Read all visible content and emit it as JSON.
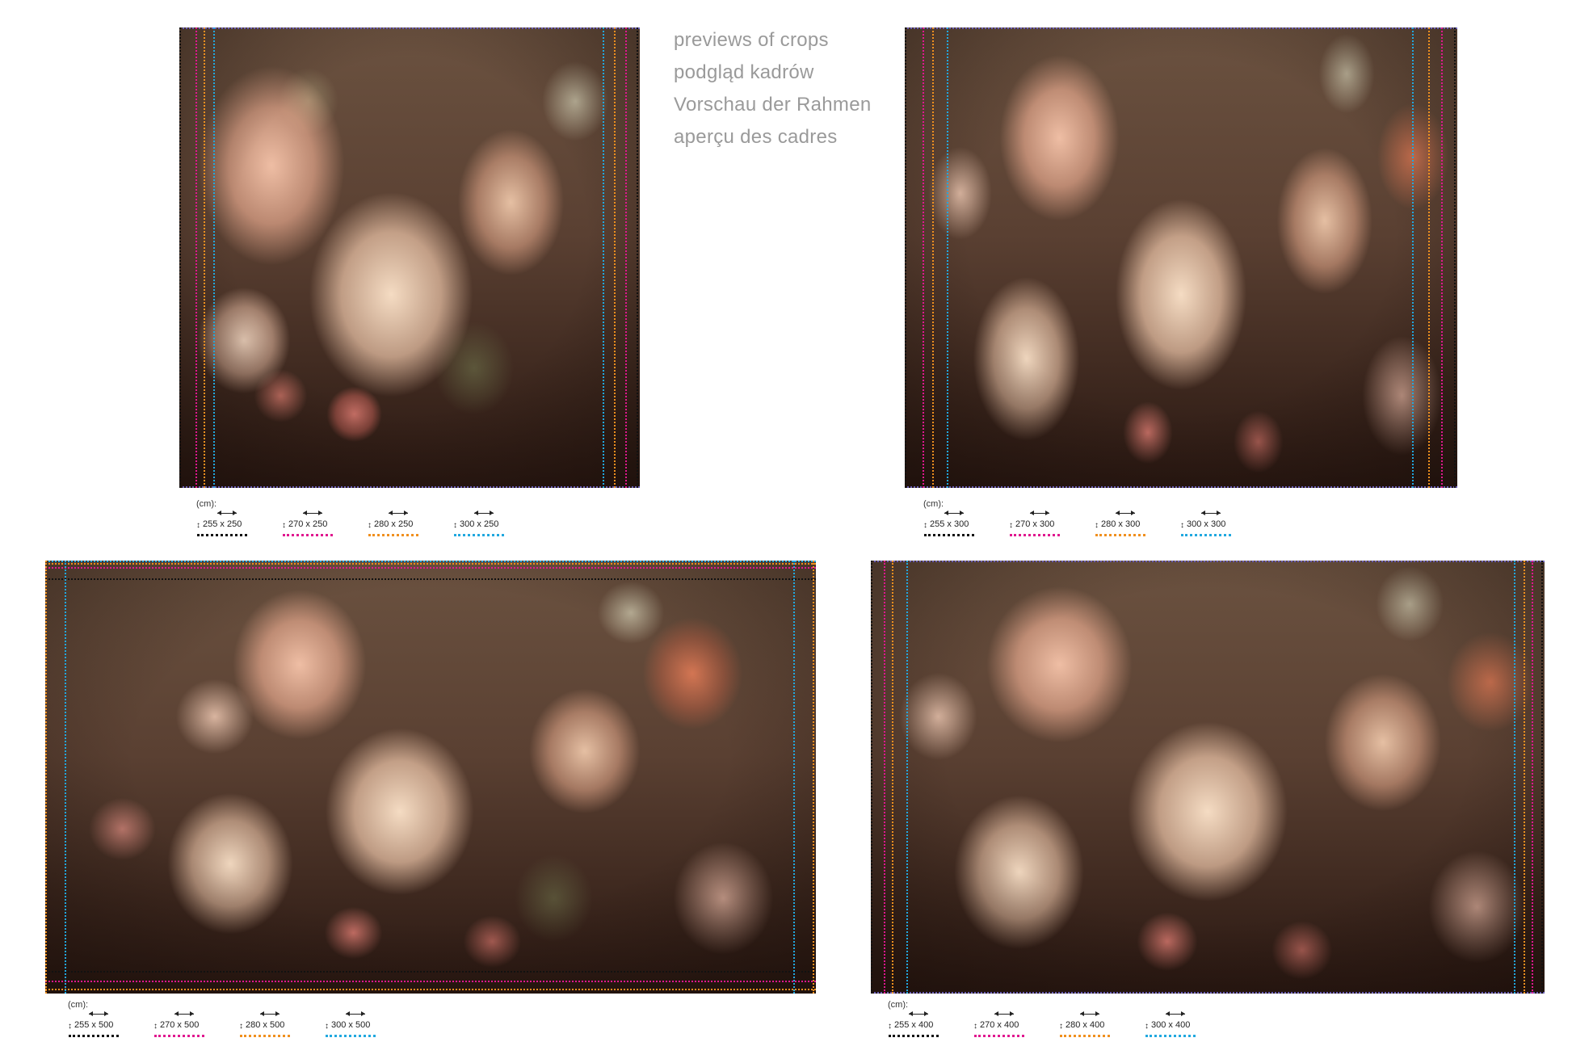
{
  "caption": {
    "lines": [
      "previews of crops",
      "podgląd kadrów",
      "Vorschau der Rahmen",
      "aperçu des cadres"
    ]
  },
  "legends": [
    {
      "unit": "(cm):",
      "sizes": [
        "255 x 250",
        "270 x 250",
        "280 x 250",
        "300 x 250"
      ]
    },
    {
      "unit": "(cm):",
      "sizes": [
        "255 x 300",
        "270 x 300",
        "280 x 300",
        "300 x 300"
      ]
    },
    {
      "unit": "(cm):",
      "sizes": [
        "255 x 500",
        "270 x 500",
        "280 x 500",
        "300 x 500"
      ]
    },
    {
      "unit": "(cm):",
      "sizes": [
        "255 x 400",
        "270 x 400",
        "280 x 400",
        "300 x 400"
      ]
    }
  ],
  "colors": {
    "black": "#111111",
    "pink": "#e0188f",
    "orange": "#f0901f",
    "blue": "#21a8df",
    "caption_text": "#9a9a9a"
  },
  "icons": [
    "vertical-dimension-arrow-icon",
    "horizontal-dimension-arrow-icon"
  ]
}
